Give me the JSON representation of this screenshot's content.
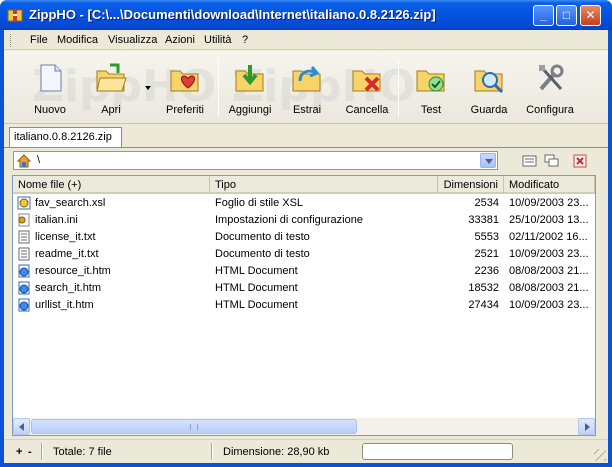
{
  "window": {
    "title": "ZippHO  - [C:\\...\\Documenti\\download\\Internet\\italiano.0.8.2126.zip]",
    "minimize_glyph": "_",
    "maximize_glyph": "□",
    "close_glyph": "✕"
  },
  "menu": {
    "items": [
      "File",
      "Modifica",
      "Visualizza",
      "Azioni",
      "Utilità",
      "?"
    ]
  },
  "toolbar": {
    "watermark": "ZippHO ZippHO",
    "buttons": [
      {
        "label": "Nuovo",
        "icon": "new-document-icon"
      },
      {
        "label": "Apri",
        "icon": "open-folder-icon"
      },
      {
        "label": "Preferiti",
        "icon": "favorites-folder-icon"
      },
      {
        "label": "Aggiungi",
        "icon": "add-to-archive-icon"
      },
      {
        "label": "Estrai",
        "icon": "extract-icon"
      },
      {
        "label": "Cancella",
        "icon": "delete-icon"
      },
      {
        "label": "Test",
        "icon": "test-icon"
      },
      {
        "label": "Guarda",
        "icon": "view-magnifier-icon"
      },
      {
        "label": "Configura",
        "icon": "configure-tools-icon"
      }
    ]
  },
  "tabs": [
    {
      "label": "italiano.0.8.2126.zip",
      "active": true
    }
  ],
  "path": {
    "value": "\\"
  },
  "list": {
    "columns": [
      "Nome file (+)",
      "Tipo",
      "Dimensioni",
      "Modificato"
    ],
    "rows": [
      {
        "name": "fav_search.xsl",
        "type": "Foglio di stile XSL",
        "size": "2534",
        "modified": "10/09/2003 23...",
        "icon": "xsl-file-icon"
      },
      {
        "name": "italian.ini",
        "type": "Impostazioni di configurazione",
        "size": "33381",
        "modified": "25/10/2003 13...",
        "icon": "ini-file-icon"
      },
      {
        "name": "license_it.txt",
        "type": "Documento di testo",
        "size": "5553",
        "modified": "02/11/2002 16...",
        "icon": "text-file-icon"
      },
      {
        "name": "readme_it.txt",
        "type": "Documento di testo",
        "size": "2521",
        "modified": "10/09/2003 23...",
        "icon": "text-file-icon"
      },
      {
        "name": "resource_it.htm",
        "type": "HTML Document",
        "size": "2236",
        "modified": "08/08/2003 21...",
        "icon": "html-file-icon"
      },
      {
        "name": "search_it.htm",
        "type": "HTML Document",
        "size": "18532",
        "modified": "08/08/2003 21...",
        "icon": "html-file-icon"
      },
      {
        "name": "urllist_it.htm",
        "type": "HTML Document",
        "size": "27434",
        "modified": "10/09/2003 23...",
        "icon": "html-file-icon"
      }
    ]
  },
  "status": {
    "plus": "+",
    "minus": "-",
    "total": "Totale: 7 file",
    "size": "Dimensione: 28,90 kb",
    "progress_fraction": 0
  }
}
